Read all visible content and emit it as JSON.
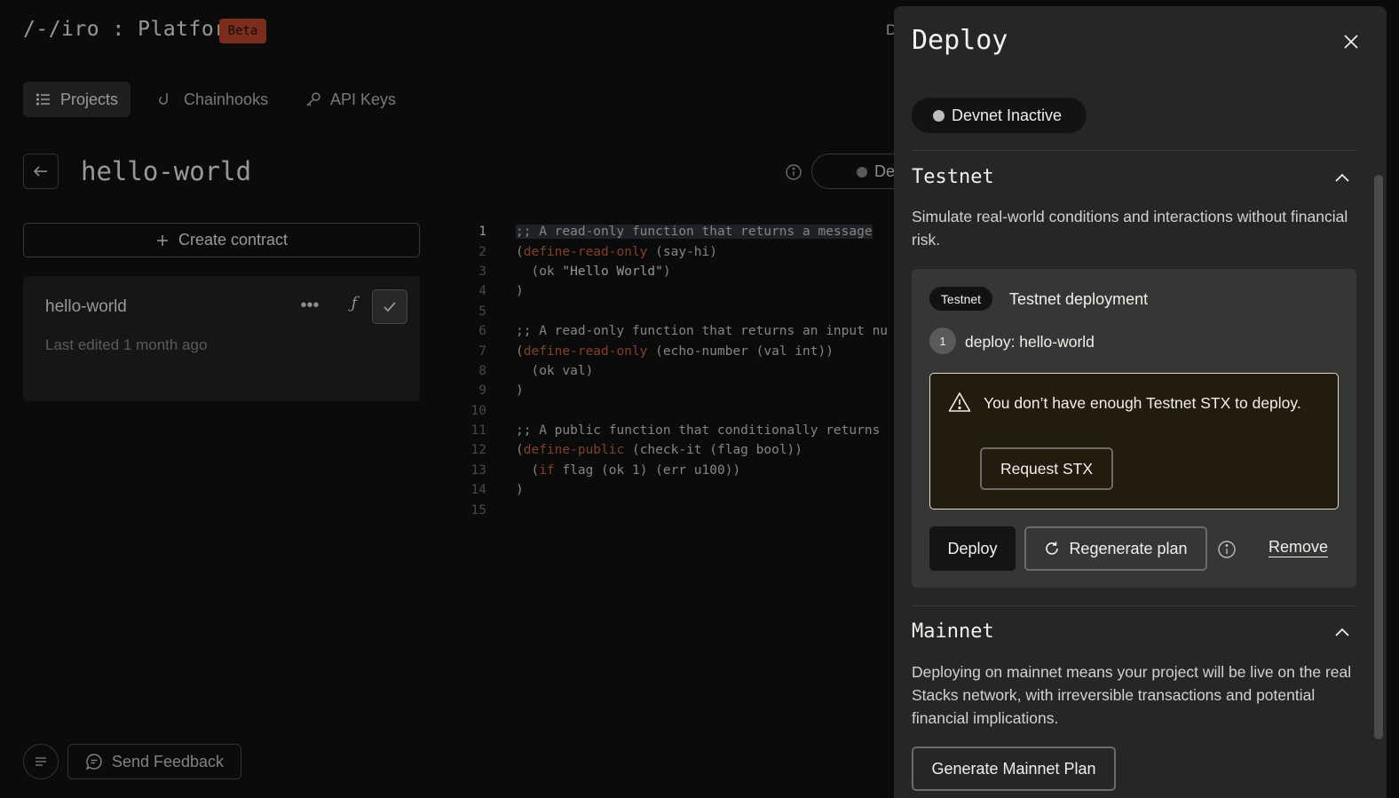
{
  "app": {
    "logo": "/-/iro : Platform",
    "beta_badge": "Beta",
    "top_right_partial": "D"
  },
  "nav": {
    "tabs": [
      {
        "label": "Projects",
        "active": true,
        "icon": "list-icon"
      },
      {
        "label": "Chainhooks",
        "active": false,
        "icon": "hook-icon"
      },
      {
        "label": "API Keys",
        "active": false,
        "icon": "key-icon"
      }
    ]
  },
  "project": {
    "title": "hello-world",
    "status_partial": "De"
  },
  "sidebar": {
    "create_contract": "Create contract",
    "contracts": [
      {
        "name": "hello-world",
        "edited": "Last edited 1 month ago"
      }
    ]
  },
  "editor": {
    "lines": [
      {
        "n": "1",
        "highlight": true
      },
      {
        "n": "2"
      },
      {
        "n": "3"
      },
      {
        "n": "4"
      },
      {
        "n": "5"
      },
      {
        "n": "6"
      },
      {
        "n": "7"
      },
      {
        "n": "8"
      },
      {
        "n": "9"
      },
      {
        "n": "10"
      },
      {
        "n": "11"
      },
      {
        "n": "12"
      },
      {
        "n": "13"
      },
      {
        "n": "14"
      },
      {
        "n": "15"
      }
    ],
    "code": {
      "l1": ";; A read-only function that returns a message",
      "l2a": "(",
      "l2b": "define-read-only",
      "l2c": " (say-hi)",
      "l3a": "  (ok ",
      "l3b": "\"Hello World\"",
      "l3c": ")",
      "l4": ")",
      "l6": ";; A read-only function that returns an input nu",
      "l7a": "(",
      "l7b": "define-read-only",
      "l7c": " (echo-number (val int))",
      "l8": "  (ok val)",
      "l9": ")",
      "l11": ";; A public function that conditionally returns",
      "l12a": "(",
      "l12b": "define-public",
      "l12c": " (check-it (flag bool))",
      "l13a": "  (",
      "l13b": "if",
      "l13c": " flag (ok 1) (err u100))",
      "l14": ")"
    }
  },
  "footer": {
    "feedback": "Send Feedback"
  },
  "deploy_panel": {
    "title": "Deploy",
    "devnet_status": "Devnet Inactive",
    "testnet": {
      "heading": "Testnet",
      "description": "Simulate real-world conditions and interactions without financial risk.",
      "badge": "Testnet",
      "card_title": "Testnet deployment",
      "step_number": "1",
      "step_label": "deploy: hello-world",
      "warning": "You don’t have enough Testnet STX to deploy.",
      "request_button": "Request STX",
      "deploy_button": "Deploy",
      "regenerate_button": "Regenerate plan",
      "remove_link": "Remove"
    },
    "mainnet": {
      "heading": "Mainnet",
      "description": "Deploying on mainnet means your project will be live on the real Stacks network, with irreversible transactions and potential financial implications.",
      "generate_button": "Generate Mainnet Plan"
    }
  },
  "colors": {
    "background": "#0b0b0b",
    "panel": "#262625",
    "beta": "#c2432b",
    "keyword": "#c7613f",
    "warning_bg": "#221b0e"
  }
}
